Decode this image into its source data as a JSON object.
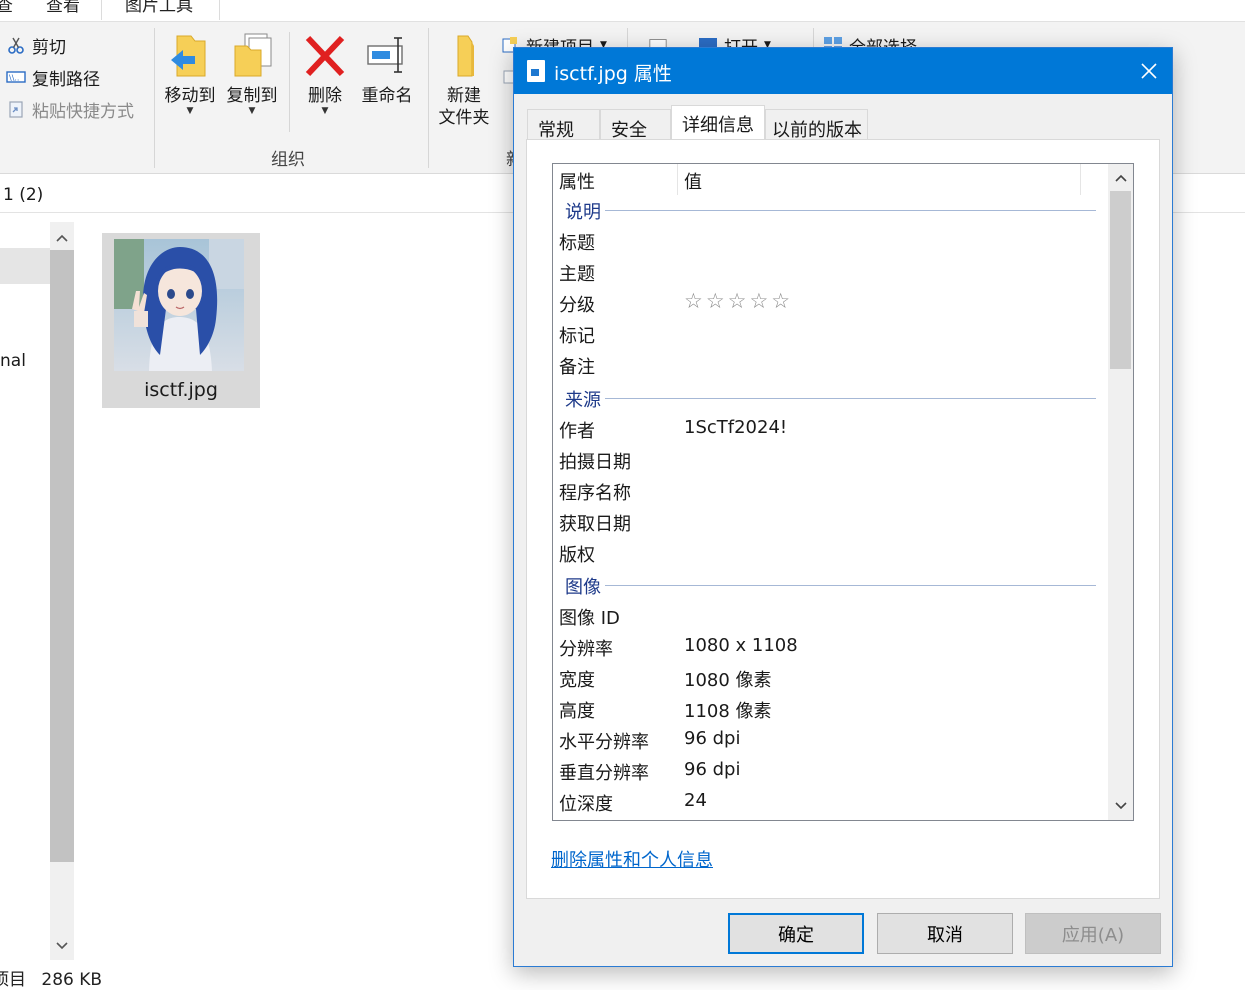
{
  "explorer": {
    "tabs": [
      {
        "label": "查"
      },
      {
        "label": "查看"
      },
      {
        "label": "图片工具"
      }
    ],
    "ribbon": {
      "clipboard": {
        "cut": "剪切",
        "copy_path": "复制路径",
        "paste_shortcut": "粘贴快捷方式"
      },
      "organize": {
        "move_to": "移动到",
        "copy_to": "复制到",
        "delete": "删除",
        "rename": "重命名",
        "group_label": "组织"
      },
      "new": {
        "new_folder_line1": "新建",
        "new_folder_line2": "文件夹",
        "new_item": "新建项目",
        "group_label_partial": "新"
      },
      "open": {
        "open_label": "打开"
      },
      "select": {
        "select_all": "全部选择"
      }
    },
    "address": {
      "path_fragment": "1 (2)"
    },
    "nav": {
      "item_partial": "nal"
    },
    "file": {
      "name": "isctf.jpg"
    },
    "status": {
      "items_partial": "项目",
      "size": "286 KB"
    }
  },
  "dialog": {
    "title": "isctf.jpg 属性",
    "tabs": [
      {
        "label": "常规",
        "active": false
      },
      {
        "label": "安全",
        "active": false
      },
      {
        "label": "详细信息",
        "active": true
      },
      {
        "label": "以前的版本",
        "active": false
      }
    ],
    "columns": {
      "property": "属性",
      "value": "值"
    },
    "groups": {
      "description": {
        "label": "说明",
        "rows": [
          {
            "name": "标题",
            "value": ""
          },
          {
            "name": "主题",
            "value": ""
          },
          {
            "name": "分级",
            "rating": 0,
            "rating_max": 5,
            "stars": "☆☆☆☆☆"
          },
          {
            "name": "标记",
            "value": ""
          },
          {
            "name": "备注",
            "value": ""
          }
        ]
      },
      "origin": {
        "label": "来源",
        "rows": [
          {
            "name": "作者",
            "value": "1ScTf2024!"
          },
          {
            "name": "拍摄日期",
            "value": ""
          },
          {
            "name": "程序名称",
            "value": ""
          },
          {
            "name": "获取日期",
            "value": ""
          },
          {
            "name": "版权",
            "value": ""
          }
        ]
      },
      "image": {
        "label": "图像",
        "rows": [
          {
            "name": "图像 ID",
            "value": ""
          },
          {
            "name": "分辨率",
            "value": "1080 x 1108"
          },
          {
            "name": "宽度",
            "value": "1080 像素"
          },
          {
            "name": "高度",
            "value": "1108 像素"
          },
          {
            "name": "水平分辨率",
            "value": "96 dpi"
          },
          {
            "name": "垂直分辨率",
            "value": "96 dpi"
          },
          {
            "name": "位深度",
            "value": "24"
          }
        ]
      }
    },
    "remove_link": "删除属性和个人信息",
    "buttons": {
      "ok": "确定",
      "cancel": "取消",
      "apply": "应用(A)"
    },
    "colors": {
      "titlebar": "#0078d7",
      "link": "#0066cc",
      "group_label": "#1e3a8a"
    }
  }
}
